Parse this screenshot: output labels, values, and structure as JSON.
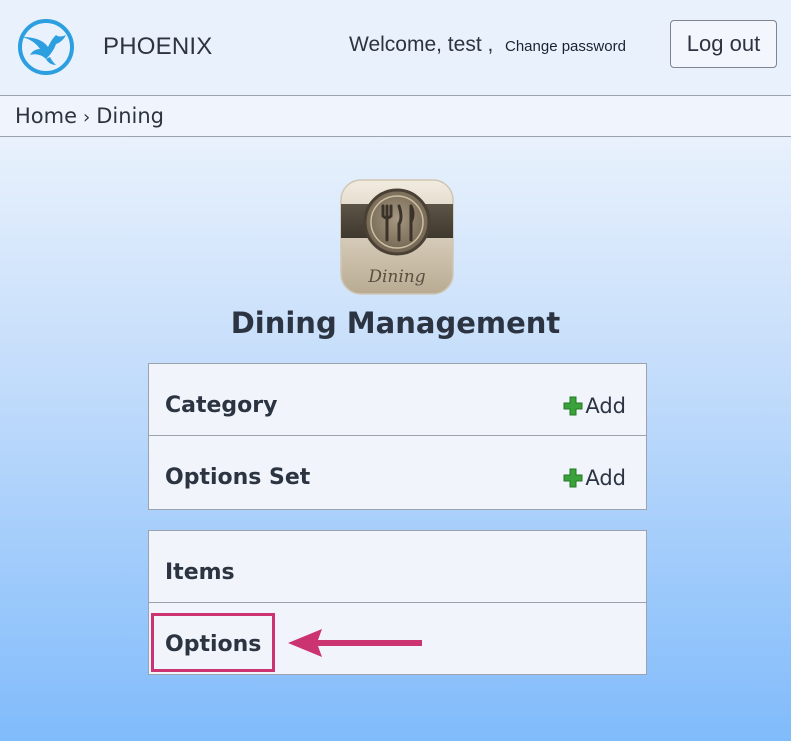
{
  "header": {
    "brand": "PHOENIX",
    "welcome": "Welcome, test ,",
    "change_password": "Change password",
    "logout": "Log out"
  },
  "breadcrumb": {
    "home": "Home",
    "separator": "›",
    "current": "Dining"
  },
  "app_icon": {
    "icon": "dining-utensils-icon",
    "caption": "Dining"
  },
  "page_title": "Dining Management",
  "panels": [
    {
      "rows": [
        {
          "label": "Category",
          "action": "Add"
        },
        {
          "label": "Options Set",
          "action": "Add"
        }
      ]
    },
    {
      "rows": [
        {
          "label": "Items"
        },
        {
          "label": "Options"
        }
      ]
    }
  ],
  "annotation": {
    "highlight_color": "#cc3371",
    "target": "Options"
  },
  "colors": {
    "logo_blue": "#2b9fe0",
    "add_green": "#3aa23a",
    "border": "#9aa3ae"
  }
}
